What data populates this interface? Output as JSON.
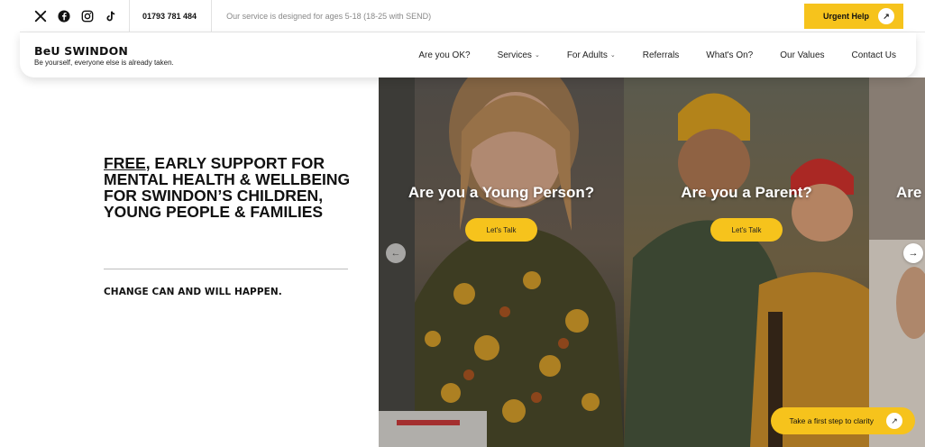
{
  "topbar": {
    "social_icons": [
      "x-icon",
      "facebook-icon",
      "instagram-icon",
      "tiktok-icon"
    ],
    "phone": "01793 781 484",
    "notice": "Our service is designed for ages 5-18 (18-25 with SEND)",
    "urgent_label": "Urgent Help"
  },
  "brand": {
    "name": "BeU SWINDON",
    "tagline": "Be yourself, everyone else is already taken."
  },
  "nav": {
    "items": [
      {
        "label": "Are you OK?",
        "has_dropdown": false
      },
      {
        "label": "Services",
        "has_dropdown": true
      },
      {
        "label": "For Adults",
        "has_dropdown": true
      },
      {
        "label": "Referrals",
        "has_dropdown": false
      },
      {
        "label": "What's On?",
        "has_dropdown": false
      },
      {
        "label": "Our Values",
        "has_dropdown": false
      },
      {
        "label": "Contact Us",
        "has_dropdown": false
      }
    ]
  },
  "hero": {
    "title_underlined": "FREE",
    "title_rest": ", EARLY SUPPORT FOR MENTAL HEALTH & WELLBEING FOR SWINDON’S CHILDREN, YOUNG PEOPLE & FAMILIES",
    "subheading": "CHANGE CAN AND WILL HAPPEN."
  },
  "slider": {
    "slides": [
      {
        "title": "Are you a Young Person?",
        "button": "Let's Talk"
      },
      {
        "title": "Are you a Parent?",
        "button": "Let's Talk"
      },
      {
        "title": "Are"
      }
    ],
    "prev_icon": "arrow-left-icon",
    "next_icon": "arrow-right-icon"
  },
  "floating_cta": {
    "label": "Take a first step to clarity"
  },
  "colors": {
    "accent_yellow": "#f6c31c",
    "text_dark": "#111111",
    "muted_text": "#888888"
  }
}
